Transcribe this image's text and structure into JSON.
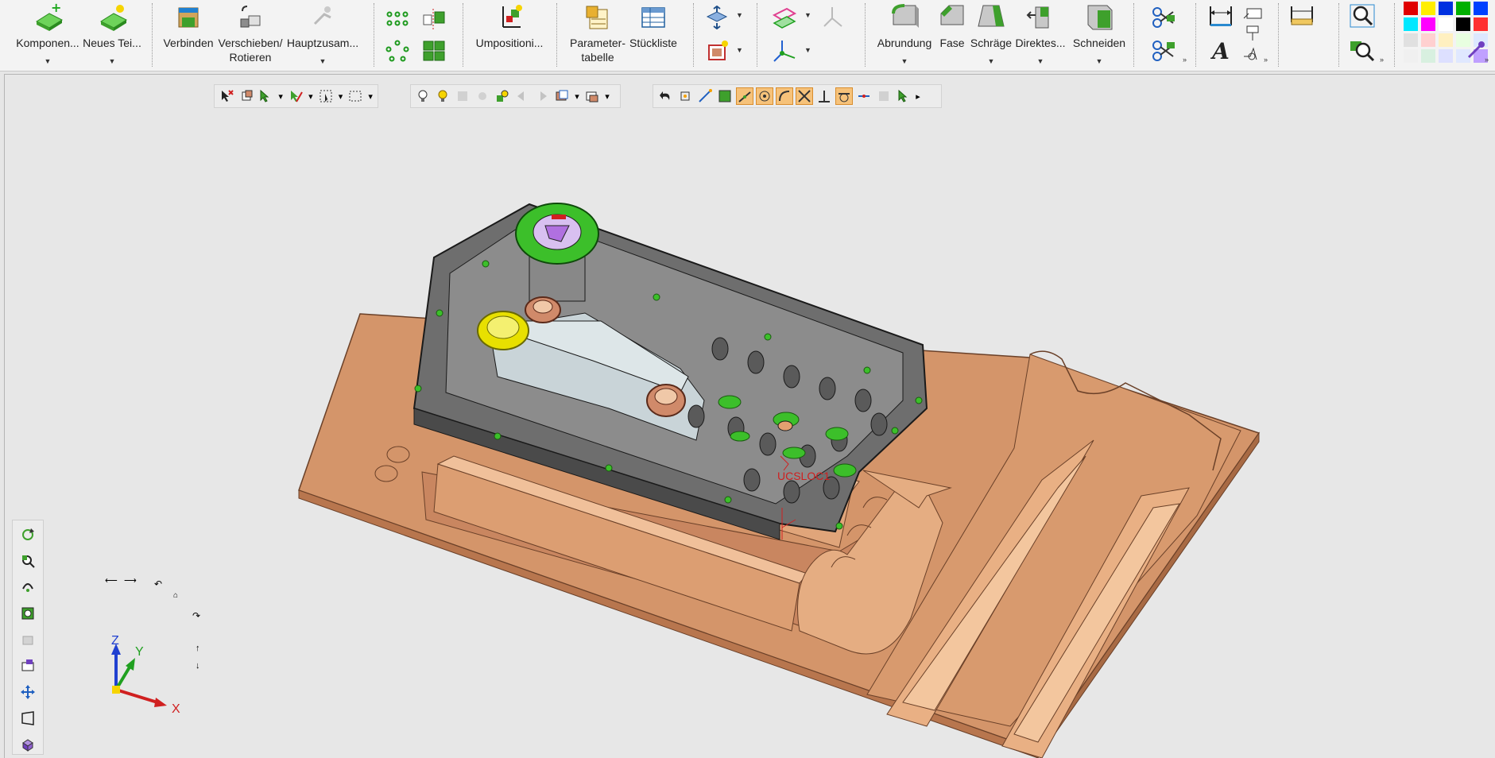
{
  "ribbon": {
    "buttons": [
      {
        "id": "komponente",
        "label": "Komponen...",
        "icon": "add-component-icon"
      },
      {
        "id": "neues-teil",
        "label": "Neues Tei...",
        "icon": "new-part-icon"
      },
      {
        "id": "verbinden",
        "label": "Verbinden",
        "icon": "connect-icon"
      },
      {
        "id": "verschieben",
        "label": "Verschieben/\nRotieren",
        "icon": "move-rotate-icon"
      },
      {
        "id": "hauptzusam",
        "label": "Hauptzusam...",
        "icon": "main-assembly-icon"
      },
      {
        "id": "umpositioni",
        "label": "Umpositioni...",
        "icon": "reposition-icon"
      },
      {
        "id": "parametertabelle",
        "label": "Parameter-\ntabelle",
        "icon": "parameter-table-icon"
      },
      {
        "id": "stueckliste",
        "label": "Stückliste",
        "icon": "bom-icon"
      },
      {
        "id": "abrundung",
        "label": "Abrundung",
        "icon": "fillet-icon"
      },
      {
        "id": "fase",
        "label": "Fase",
        "icon": "chamfer-icon"
      },
      {
        "id": "schraege",
        "label": "Schräge",
        "icon": "draft-icon"
      },
      {
        "id": "direktes",
        "label": "Direktes...",
        "icon": "direct-edit-icon"
      },
      {
        "id": "schneiden",
        "label": "Schneiden",
        "icon": "cut-icon"
      }
    ],
    "palette": [
      "#e00000",
      "#ffee00",
      "#0030e0",
      "#00b000",
      "#0040ff",
      "#00e8ff",
      "#ff00ff",
      "#ffffff",
      "#000000",
      "#ff3030",
      "#e0e0e0",
      "#ffd0d0",
      "#fff0c0",
      "#e8ffe0",
      "#dde8ff",
      "#f0f0f0",
      "#d8f0e0",
      "#dde0ff",
      "#e0e8ff",
      "#c0a0ff"
    ]
  },
  "viewport": {
    "coord_label": "UCSLOC1",
    "axes": {
      "x": "X",
      "y": "Y",
      "z": "Z"
    },
    "colors": {
      "tray": "#d4956a",
      "tray_dark": "#b8764e",
      "cover": "#6e6e6e",
      "cover_light": "#c9d4d8",
      "accent_green": "#3cbf2a",
      "accent_yellow": "#e8e000",
      "accent_purple": "#b070e0"
    }
  }
}
